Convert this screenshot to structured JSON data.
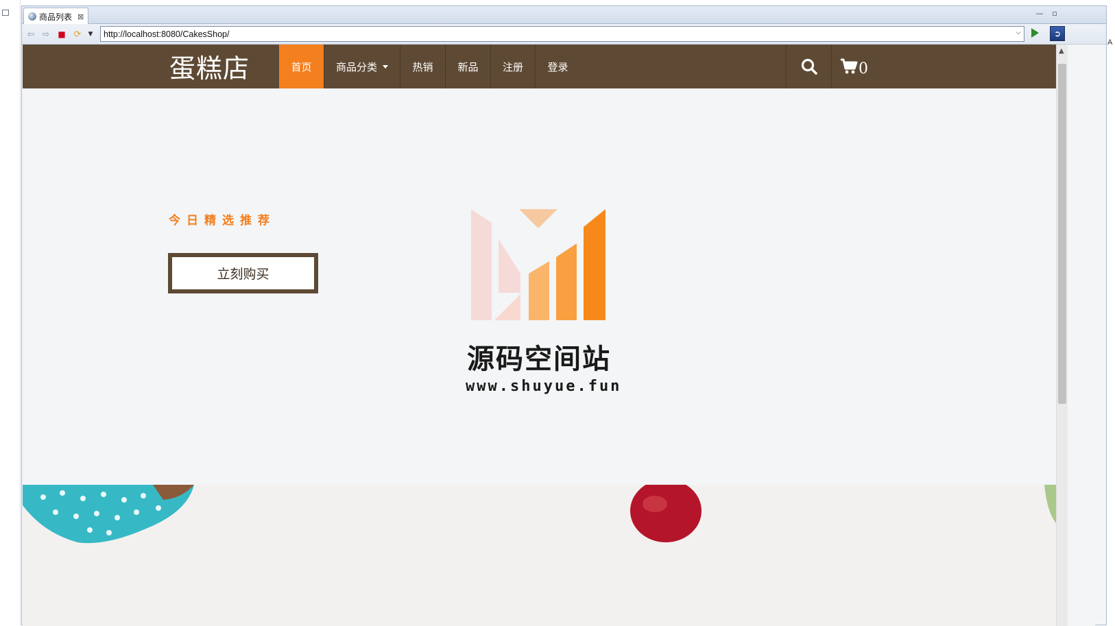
{
  "browser": {
    "tab_title": "商品列表",
    "url": "http://localhost:8080/CakesShop/"
  },
  "site": {
    "brand": "蛋糕店",
    "nav": [
      {
        "label": "首页",
        "active": true
      },
      {
        "label": "商品分类",
        "dropdown": true
      },
      {
        "label": "热销"
      },
      {
        "label": "新品"
      },
      {
        "label": "注册"
      },
      {
        "label": "登录"
      }
    ],
    "cart_count": "0",
    "icons": [
      "search-icon",
      "cart-icon"
    ]
  },
  "hero": {
    "tagline": "今日精选推荐",
    "button_label": "立刻购买"
  },
  "watermark": {
    "title": "源码空间站",
    "url": "www.shuyue.fun"
  },
  "colors": {
    "nav_bg": "#5e4a34",
    "accent": "#f37f1f",
    "page_bg": "#f3f5f7"
  }
}
